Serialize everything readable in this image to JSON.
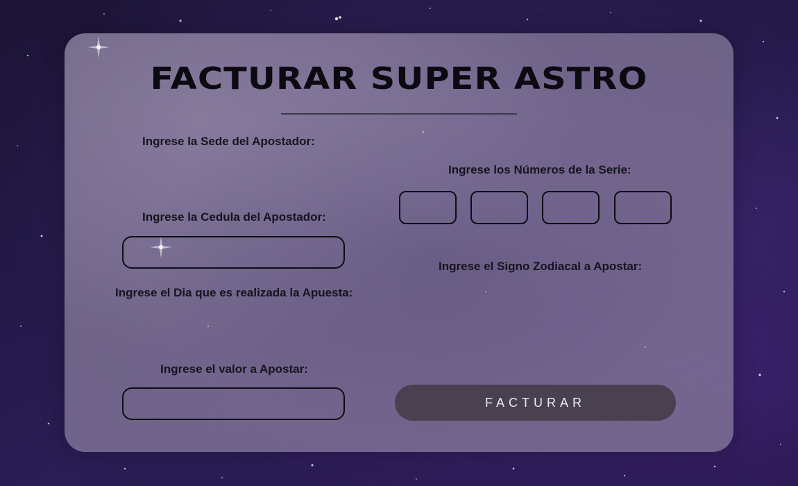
{
  "title": "FACTURAR SUPER ASTRO",
  "form": {
    "sede_label": "Ingrese la Sede del Apostador:",
    "cedula_label": "Ingrese la Cedula del Apostador:",
    "cedula_value": "",
    "dia_label": "Ingrese el Dia que es realizada la Apuesta:",
    "valor_label": "Ingrese el valor a Apostar:",
    "valor_value": "",
    "serie_label": "Ingrese los Números de la Serie:",
    "serie_values": [
      "",
      "",
      "",
      ""
    ],
    "signo_label": "Ingrese el Signo Zodiacal a Apostar:",
    "submit_label": "FACTURAR"
  },
  "colors": {
    "background": "#241a4a",
    "card": "#8c80a0",
    "button": "#4a4150",
    "button_text": "#ece8f2",
    "text": "#15151e"
  }
}
